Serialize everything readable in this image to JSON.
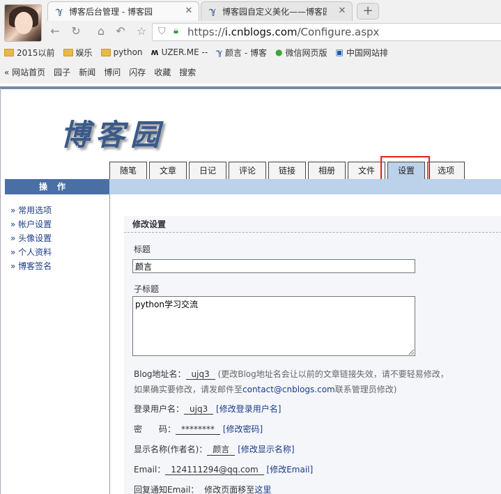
{
  "browser": {
    "tabs": [
      {
        "title": "博客后台管理 - 博客园",
        "active": true
      },
      {
        "title": "博客园自定义美化——博客园IT",
        "active": false
      }
    ],
    "url_prefix": "https://",
    "url_host": "i.cnblogs.com",
    "url_path": "/Configure.aspx",
    "bookmarks": [
      {
        "label": "2015以前",
        "icon": "folder-icon"
      },
      {
        "label": "娱乐",
        "icon": "folder-icon"
      },
      {
        "label": "python",
        "icon": "folder-icon"
      },
      {
        "label": "UZER.ME --",
        "icon": "uzer-icon"
      },
      {
        "label": "颜言 - 博客",
        "icon": "cnblogs-icon"
      },
      {
        "label": "微信网页版",
        "icon": "wechat-icon"
      },
      {
        "label": "中国网站排",
        "icon": "chinaz-icon"
      }
    ]
  },
  "site_nav": [
    "« 网站首页",
    "园子",
    "新闻",
    "博问",
    "闪存",
    "收藏",
    "搜索"
  ],
  "logo_text": "博客园",
  "page_tabs": [
    {
      "label": "随笔",
      "active": false
    },
    {
      "label": "文章",
      "active": false
    },
    {
      "label": "日记",
      "active": false
    },
    {
      "label": "评论",
      "active": false
    },
    {
      "label": "链接",
      "active": false
    },
    {
      "label": "相册",
      "active": false
    },
    {
      "label": "文件",
      "active": false
    },
    {
      "label": "设置",
      "active": true
    },
    {
      "label": "选项",
      "active": false
    }
  ],
  "sidebar": {
    "header": "操作",
    "items": [
      "常用选项",
      "帐户设置",
      "头像设置",
      "个人资料",
      "博客签名"
    ]
  },
  "panel": {
    "title": "修改设置",
    "title_label": "标题",
    "title_value": "颜言",
    "subtitle_label": "子标题",
    "subtitle_value": "python学习交流",
    "blog_addr_label": "Blog地址名：",
    "blog_addr_value": "ujq3",
    "blog_addr_note1": "(更改Blog地址名会让以前的文章链接失效，请不要轻易修改，",
    "blog_addr_note2": "如果确实要修改，请发邮件至",
    "blog_addr_email": "contact@cnblogs.com",
    "blog_addr_note3": "联系管理员修改)",
    "login_label": "登录用户名：",
    "login_value": "ujq3",
    "login_link": "[修改登录用户名]",
    "pwd_label": "密　　码：",
    "pwd_value": "********",
    "pwd_link": "[修改密码]",
    "display_label": "显示名称(作者名)：",
    "display_value": "颜言",
    "display_link": "[修改显示名称]",
    "email_label": "Email：",
    "email_value": "124111294@qq.com",
    "email_link": "[修改Email]",
    "reply_label": "回复通知Email：",
    "reply_value": "修改页面移至",
    "reply_link": "这里"
  }
}
